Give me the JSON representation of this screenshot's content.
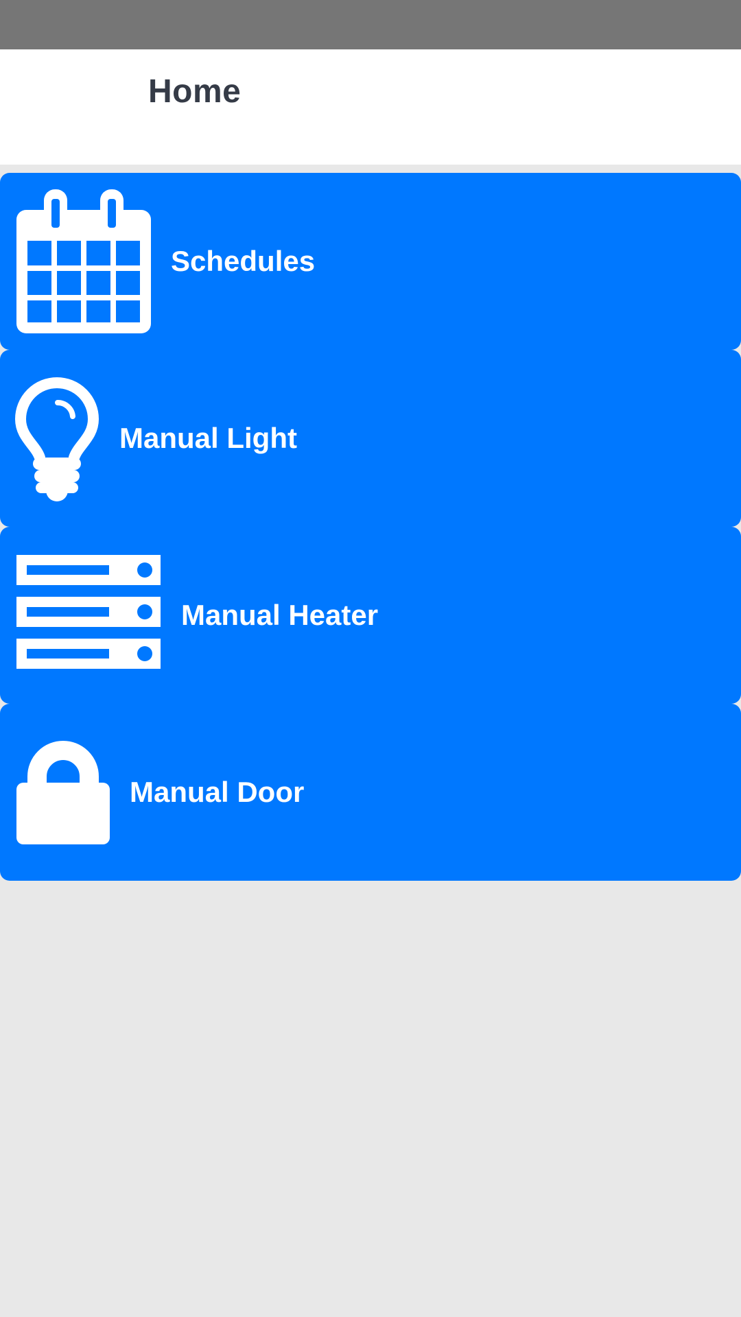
{
  "header": {
    "title": "Home"
  },
  "menu": {
    "items": [
      {
        "id": "schedules",
        "label": "Schedules",
        "icon": "calendar-icon"
      },
      {
        "id": "manual-light",
        "label": "Manual Light",
        "icon": "lightbulb-icon"
      },
      {
        "id": "manual-heater",
        "label": "Manual Heater",
        "icon": "server-icon"
      },
      {
        "id": "manual-door",
        "label": "Manual Door",
        "icon": "lock-icon"
      }
    ]
  },
  "colors": {
    "status_bar": "#767676",
    "header_bg": "#ffffff",
    "title_text": "#353b47",
    "accent": "#0078ff",
    "page_bg": "#e8e8e8",
    "item_text": "#ffffff"
  }
}
